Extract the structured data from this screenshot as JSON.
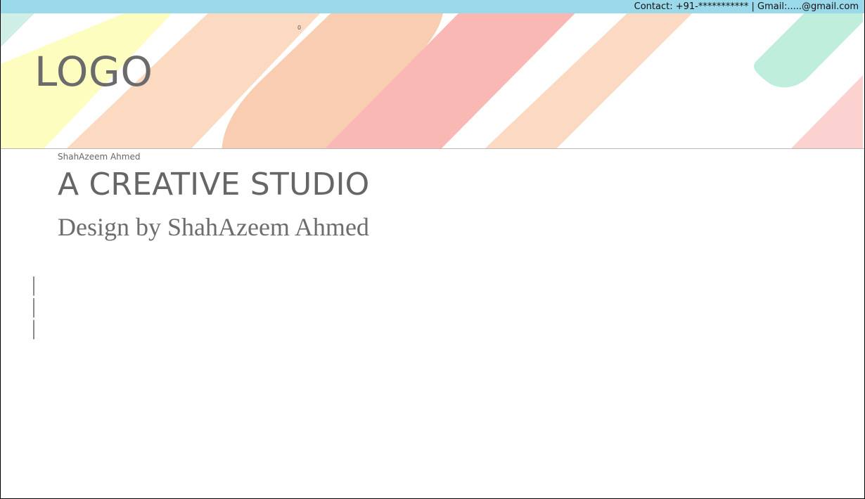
{
  "topbar": {
    "contact": "Contact: +91-*********** | Gmail:.....@gmail.com"
  },
  "hero": {
    "logo": "LOGO",
    "counter": "0",
    "colors": {
      "mint": "#bfeedd",
      "yellow": "#fdfdbf",
      "peach": "#fcd9c1",
      "salmon": "#f9b8b4",
      "pink": "#fcd2d1",
      "light_orange": "#fbd9c2"
    }
  },
  "content": {
    "author_small": "ShahAzeem Ahmed",
    "main_title": "A CREATIVE STUDIO",
    "subtitle": "Design by ShahAzeem Ahmed"
  },
  "ui": {
    "cursor_lines_icon": "cursor-lines-icon"
  }
}
